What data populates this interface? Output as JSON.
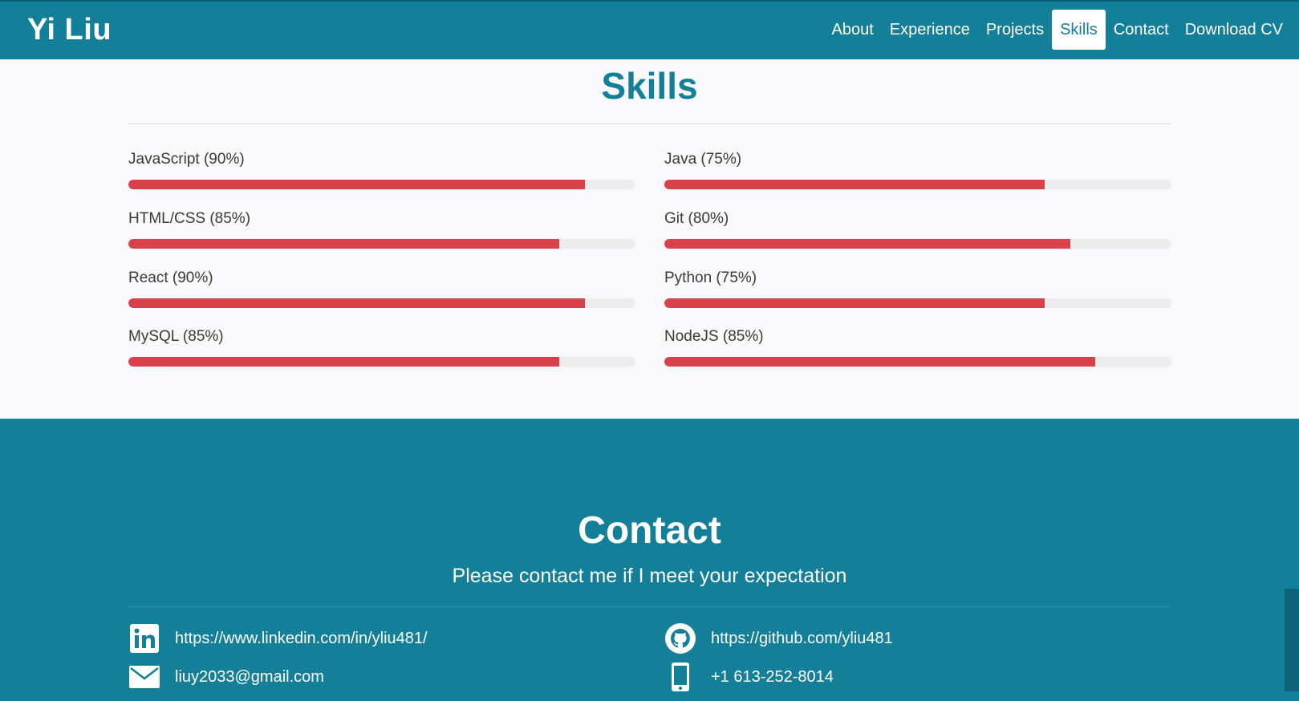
{
  "brand": "Yi Liu",
  "nav": {
    "items": [
      {
        "label": "About"
      },
      {
        "label": "Experience"
      },
      {
        "label": "Projects"
      },
      {
        "label": "Skills"
      },
      {
        "label": "Contact"
      },
      {
        "label": "Download CV"
      }
    ],
    "active": "Skills"
  },
  "skills": {
    "title": "Skills",
    "items": [
      {
        "label": "JavaScript (90%)",
        "level": 0.9
      },
      {
        "label": "Java (75%)",
        "level": 0.75
      },
      {
        "label": "HTML/CSS (85%)",
        "level": 0.85
      },
      {
        "label": "Git (80%)",
        "level": 0.8
      },
      {
        "label": "React (90%)",
        "level": 0.9
      },
      {
        "label": "Python (75%)",
        "level": 0.75
      },
      {
        "label": "MySQL (85%)",
        "level": 0.85
      },
      {
        "label": "NodeJS (85%)",
        "level": 0.85
      }
    ],
    "bar_color": "#d9414a",
    "track_color": "#ececec"
  },
  "contact": {
    "title": "Contact",
    "subtitle": "Please contact me if I meet your expectation",
    "linkedin": "https://www.linkedin.com/in/yliu481/",
    "github": "https://github.com/yliu481",
    "email": "liuy2033@gmail.com",
    "phone": "+1 613-252-8014"
  },
  "colors": {
    "primary": "#147f98",
    "background": "#f9f9fc"
  }
}
